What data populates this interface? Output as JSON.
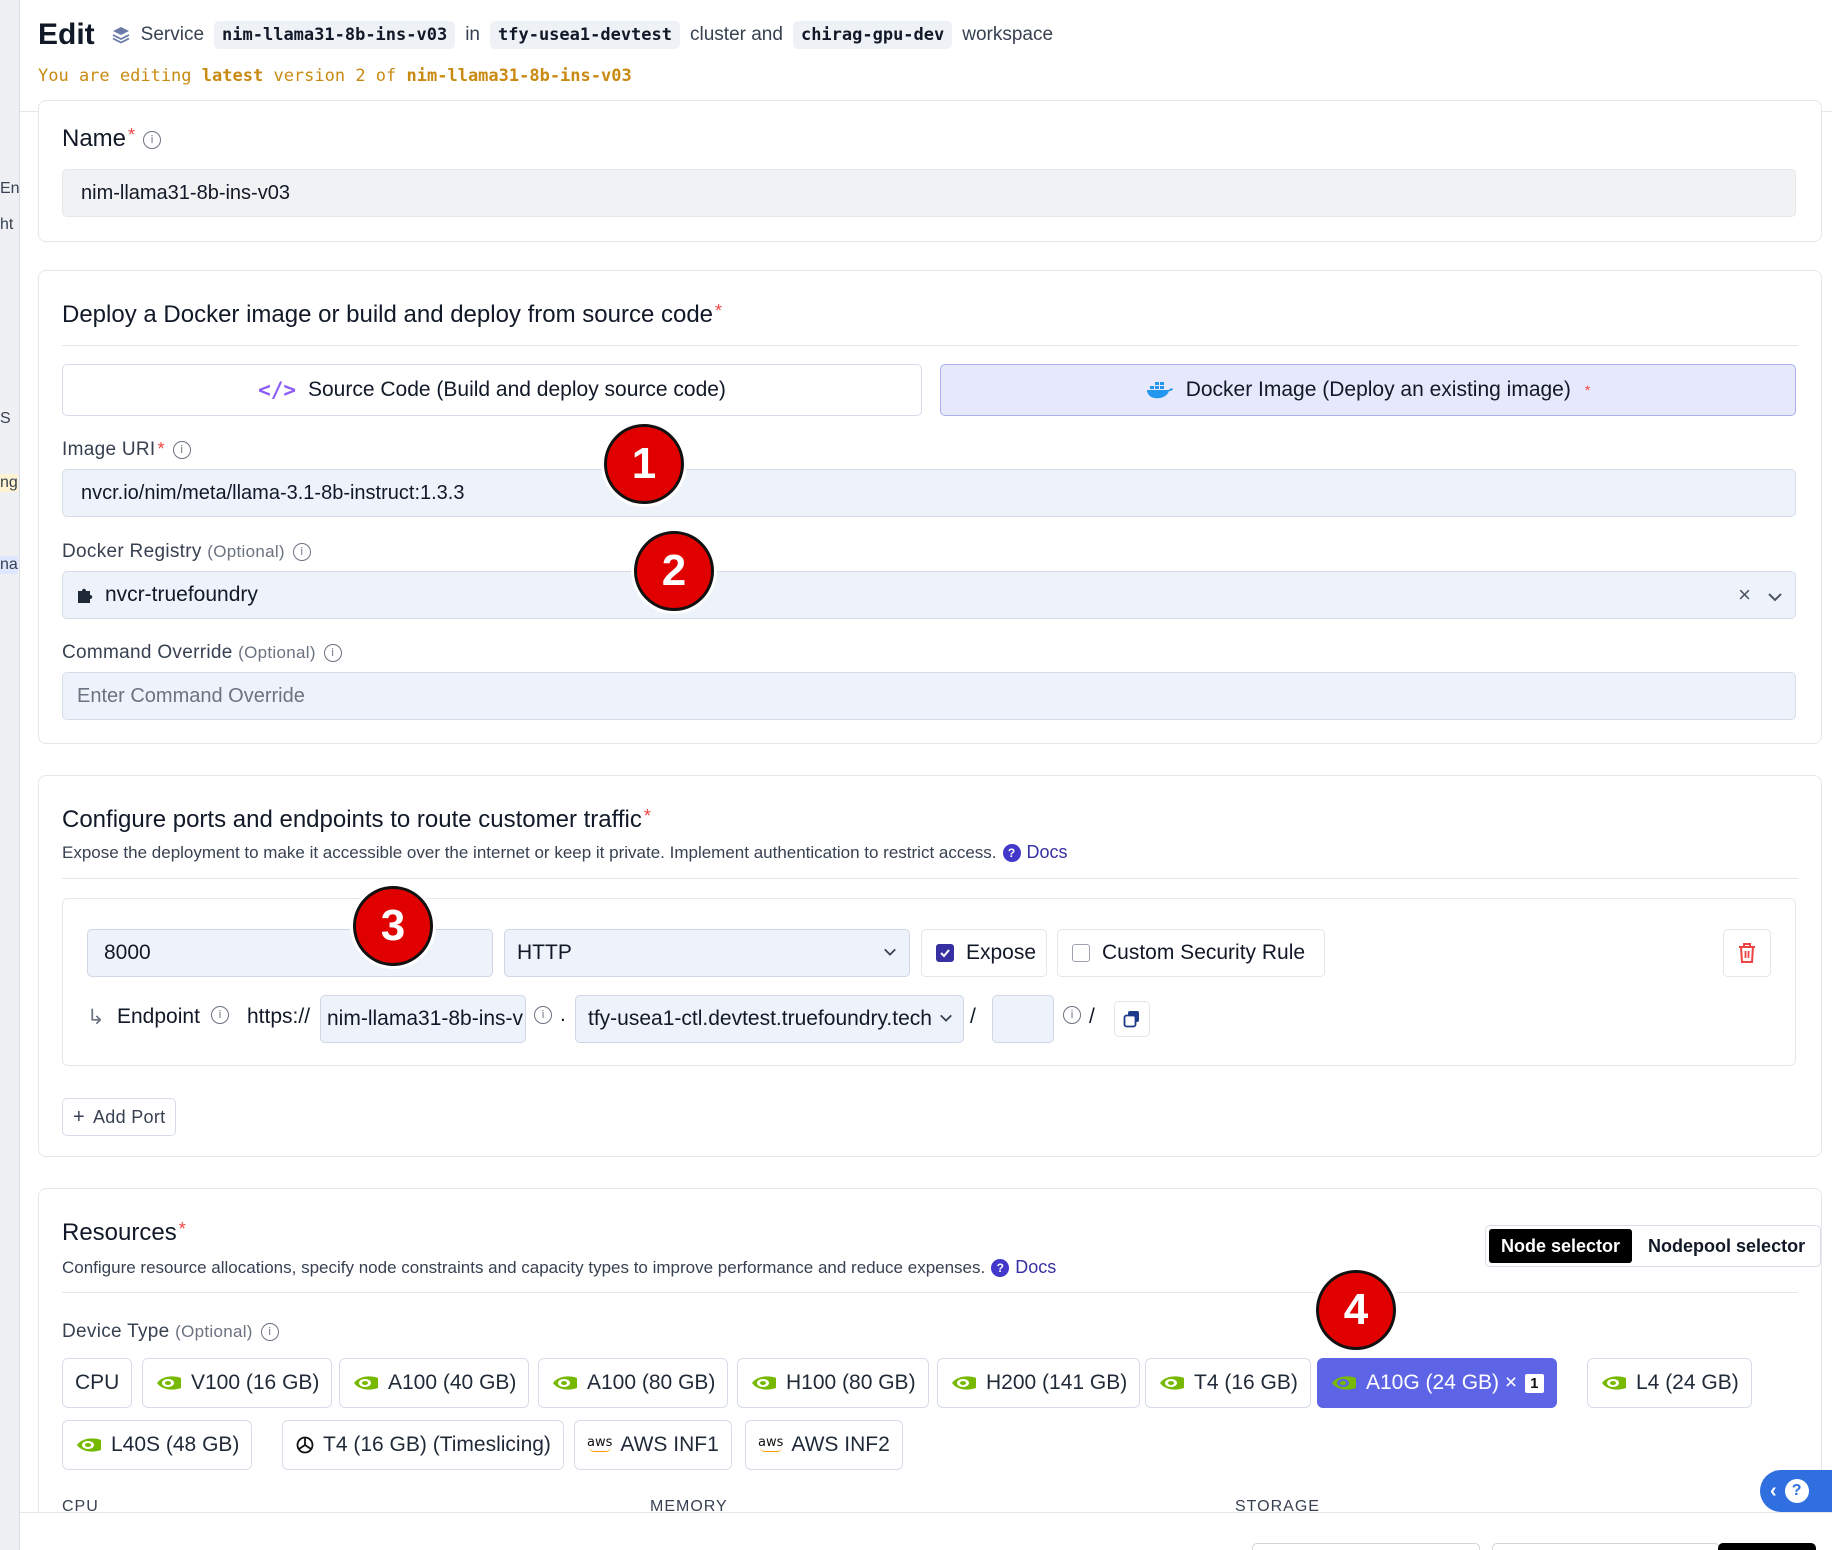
{
  "header": {
    "title": "Edit",
    "resource_type": "Service",
    "service_name": "nim-llama31-8b-ins-v03",
    "in_text": "in",
    "cluster_name": "tfy-usea1-devtest",
    "cluster_text": "cluster and",
    "workspace_name": "chirag-gpu-dev",
    "workspace_text": "workspace",
    "subtitle_prefix": "You are editing",
    "subtitle_latest": "latest",
    "subtitle_mid": "version 2 of",
    "subtitle_name": "nim-llama31-8b-ins-v03"
  },
  "left_strip": [
    "En",
    "ht",
    "S",
    "ng",
    "na"
  ],
  "name_section": {
    "label": "Name",
    "value": "nim-llama31-8b-ins-v03"
  },
  "deploy_section": {
    "title": "Deploy a Docker image or build and deploy from source code",
    "source_code_label": "Source Code (Build and deploy source code)",
    "docker_image_label": "Docker Image (Deploy an existing image)",
    "image_uri_label": "Image URI",
    "image_uri_value": "nvcr.io/nim/meta/llama-3.1-8b-instruct:1.3.3",
    "registry_label": "Docker Registry",
    "registry_optional": "(Optional)",
    "registry_value": "nvcr-truefoundry",
    "command_label": "Command Override",
    "command_optional": "(Optional)",
    "command_placeholder": "Enter Command Override"
  },
  "ports_section": {
    "title": "Configure ports and endpoints to route customer traffic",
    "description": "Expose the deployment to make it accessible over the internet or keep it private. Implement authentication to restrict access.",
    "docs_label": "Docs",
    "port_value": "8000",
    "protocol_value": "HTTP",
    "expose_label": "Expose",
    "expose_checked": true,
    "custom_rule_label": "Custom Security Rule",
    "custom_rule_checked": false,
    "endpoint_label": "Endpoint",
    "scheme": "https://",
    "host_value": "nim-llama31-8b-ins-v",
    "dot": ".",
    "domain_value": "tfy-usea1-ctl.devtest.truefoundry.tech",
    "slash": "/",
    "path_value": "",
    "slash2": "/",
    "add_port_label": "Add Port"
  },
  "resources_section": {
    "title": "Resources",
    "description": "Configure resource allocations, specify node constraints and capacity types to improve performance and reduce expenses.",
    "docs_label": "Docs",
    "node_selector_label": "Node selector",
    "nodepool_selector_label": "Nodepool selector",
    "device_type_label": "Device Type",
    "device_type_optional": "(Optional)",
    "devices": [
      {
        "label": "CPU",
        "icon": "none"
      },
      {
        "label": "V100 (16 GB)",
        "icon": "nvidia-icon"
      },
      {
        "label": "A100 (40 GB)",
        "icon": "nvidia-icon"
      },
      {
        "label": "A100 (80 GB)",
        "icon": "nvidia-icon"
      },
      {
        "label": "H100 (80 GB)",
        "icon": "nvidia-icon"
      },
      {
        "label": "H200 (141 GB)",
        "icon": "nvidia-icon"
      },
      {
        "label": "T4 (16 GB)",
        "icon": "nvidia-icon"
      },
      {
        "label": "A10G (24 GB) ×",
        "icon": "nvidia-icon",
        "selected": true,
        "count": "1"
      },
      {
        "label": "L4 (24 GB)",
        "icon": "nvidia-icon"
      },
      {
        "label": "L40S (48 GB)",
        "icon": "nvidia-icon"
      },
      {
        "label": "T4 (16 GB) (Timeslicing)",
        "icon": "timeslice-icon"
      },
      {
        "label": "AWS INF1",
        "icon": "aws-icon"
      },
      {
        "label": "AWS INF2",
        "icon": "aws-icon"
      }
    ],
    "columns": [
      "CPU",
      "MEMORY",
      "STORAGE"
    ]
  },
  "annotations": [
    "1",
    "2",
    "3",
    "4"
  ],
  "colors": {
    "accent": "#5e64e6",
    "warning_text": "#c98a12",
    "badge_red": "#e00000",
    "required": "#ef4444"
  }
}
